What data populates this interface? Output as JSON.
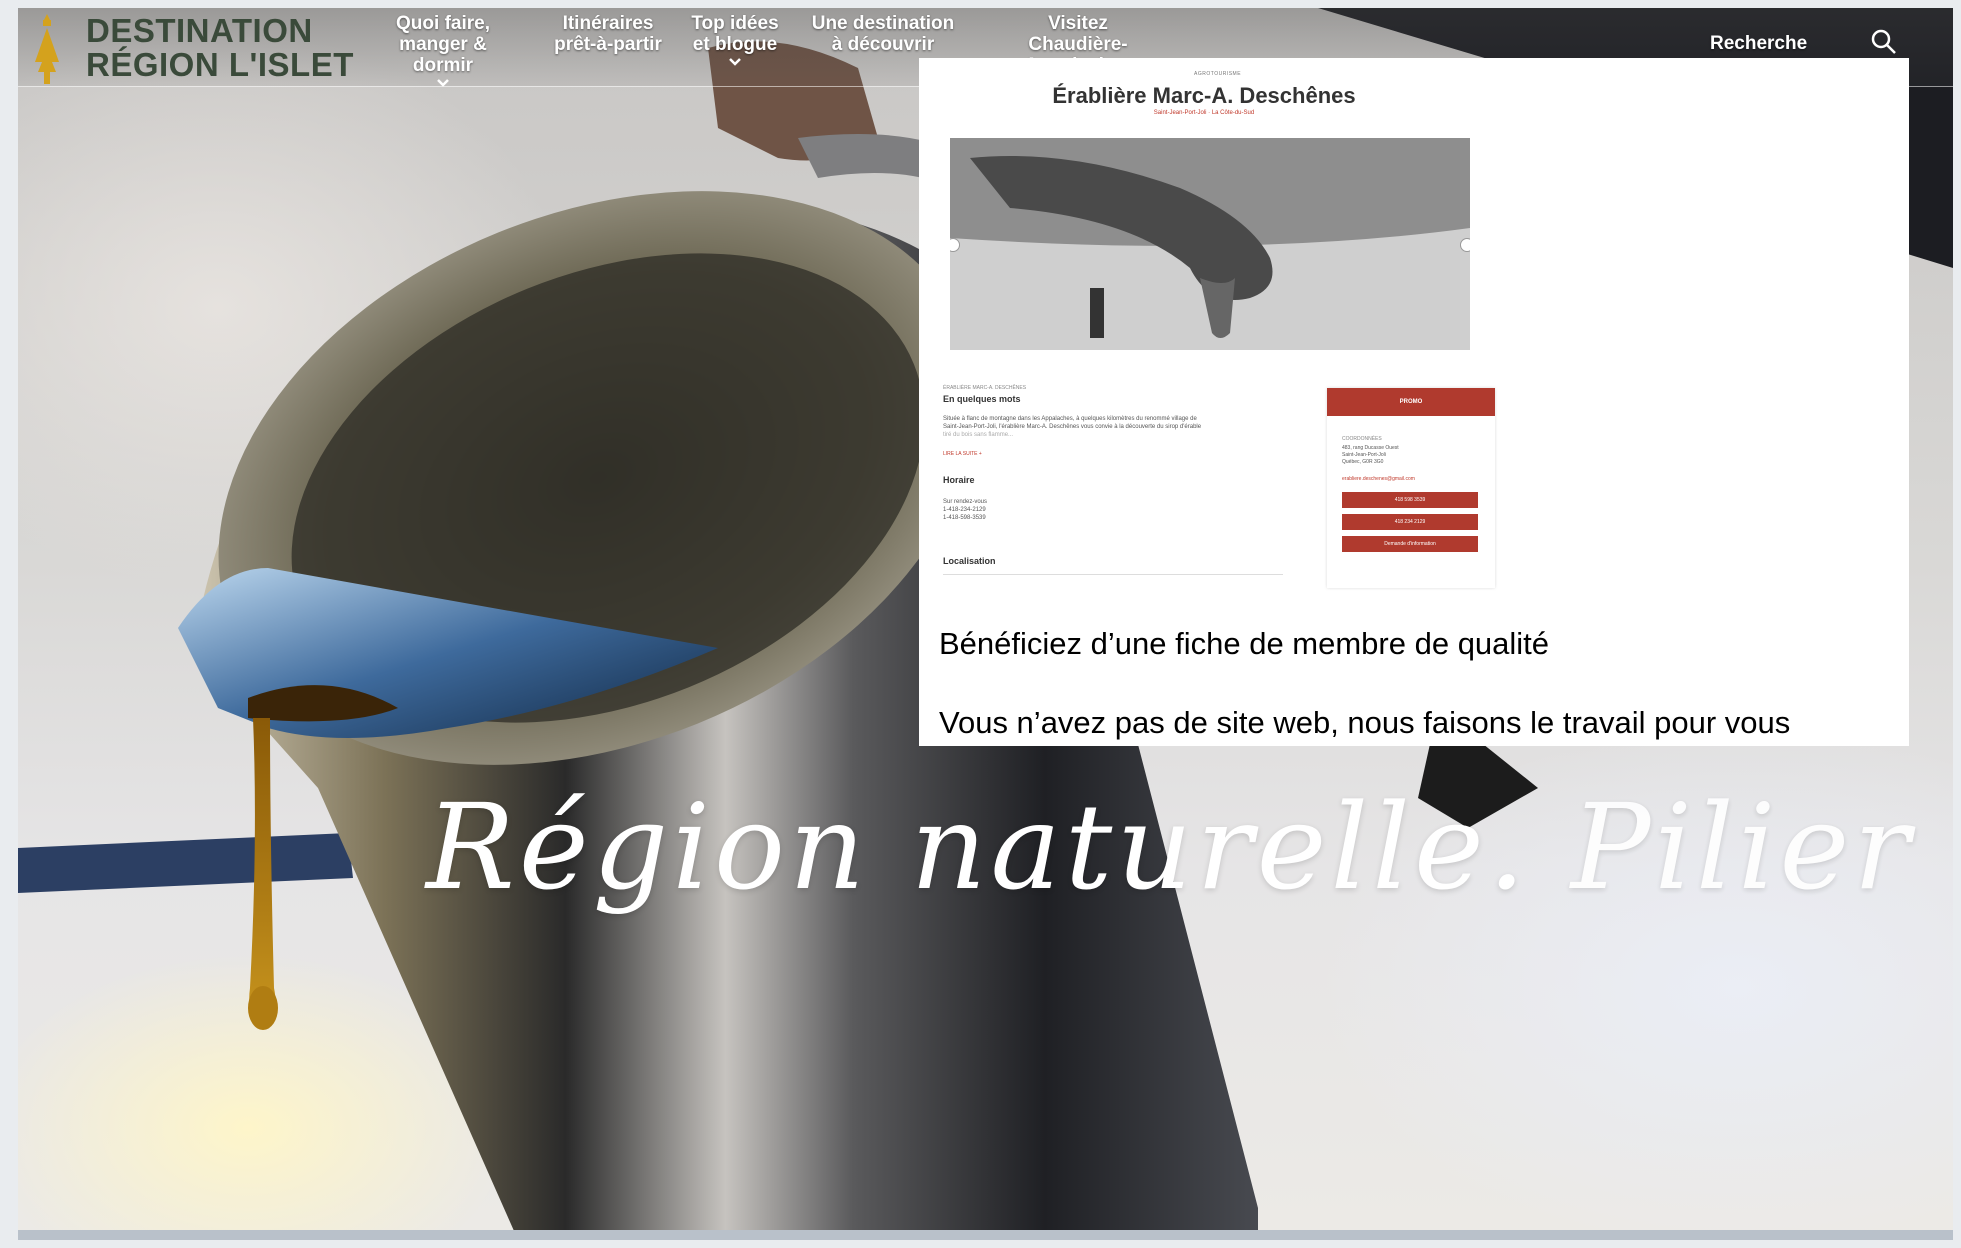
{
  "logo": {
    "line1": "DESTINATION",
    "line2": "RÉGION L'ISLET"
  },
  "nav": [
    {
      "line1": "Quoi faire,",
      "line2": "manger & dormir"
    },
    {
      "line1": "Itinéraires",
      "line2": "prêt-à-partir"
    },
    {
      "line1": "Top idées",
      "line2": "et blogue"
    },
    {
      "line1": "Une destination",
      "line2": "à découvrir"
    },
    {
      "line1": "Visitez",
      "line2": "Chaudière-Appalaches"
    }
  ],
  "search": {
    "label": "Recherche"
  },
  "hero": {
    "tagline_a": "Région naturelle.",
    "tagline_b": "Pilier culturel."
  },
  "card": {
    "eyebrow": "AGROTOURISME",
    "title": "Érablière Marc-A. Deschênes",
    "location": "Saint-Jean-Port-Joli · La Côte-du-Sud",
    "intro_eyebrow": "ÉRABLIÈRE MARC-A. DESCHÊNES",
    "intro_title": "En quelques mots",
    "intro_text1": "Située à flanc de montagne dans les Appalaches, à quelques kilomètres du renommé village de",
    "intro_text2": "Saint-Jean-Port-Joli, l'érablière Marc-A. Deschênes vous convie à la découverte du sirop d'érable",
    "intro_text3": "tiré du bois sans flamme...",
    "read_more": "LIRE LA SUITE +",
    "hours_title": "Horaire",
    "hours_1": "Sur rendez-vous",
    "hours_2": "1-418-234-2129",
    "hours_3": "1-418-598-3539",
    "location_title": "Localisation",
    "side_header": "PROMO",
    "coords_label": "COORDONNÉES",
    "address1": "483, rang Ducasse Ouest",
    "address2": "Saint-Jean-Port-Joli",
    "address3": "Québec, G0R 3G0",
    "email": "erabliere.deschenes@gmail.com",
    "btn1": "418 598 3539",
    "btn2": "418 234 2129",
    "btn3": "Demande d'information",
    "caption1": "Bénéficiez d’une fiche de membre de qualité",
    "caption2": "Vous n’avez pas de site web, nous faisons le travail pour vous"
  },
  "colors": {
    "accent_red": "#b03a2e",
    "logo_green": "#3a4a3a",
    "logo_gold": "#d4a21d"
  }
}
